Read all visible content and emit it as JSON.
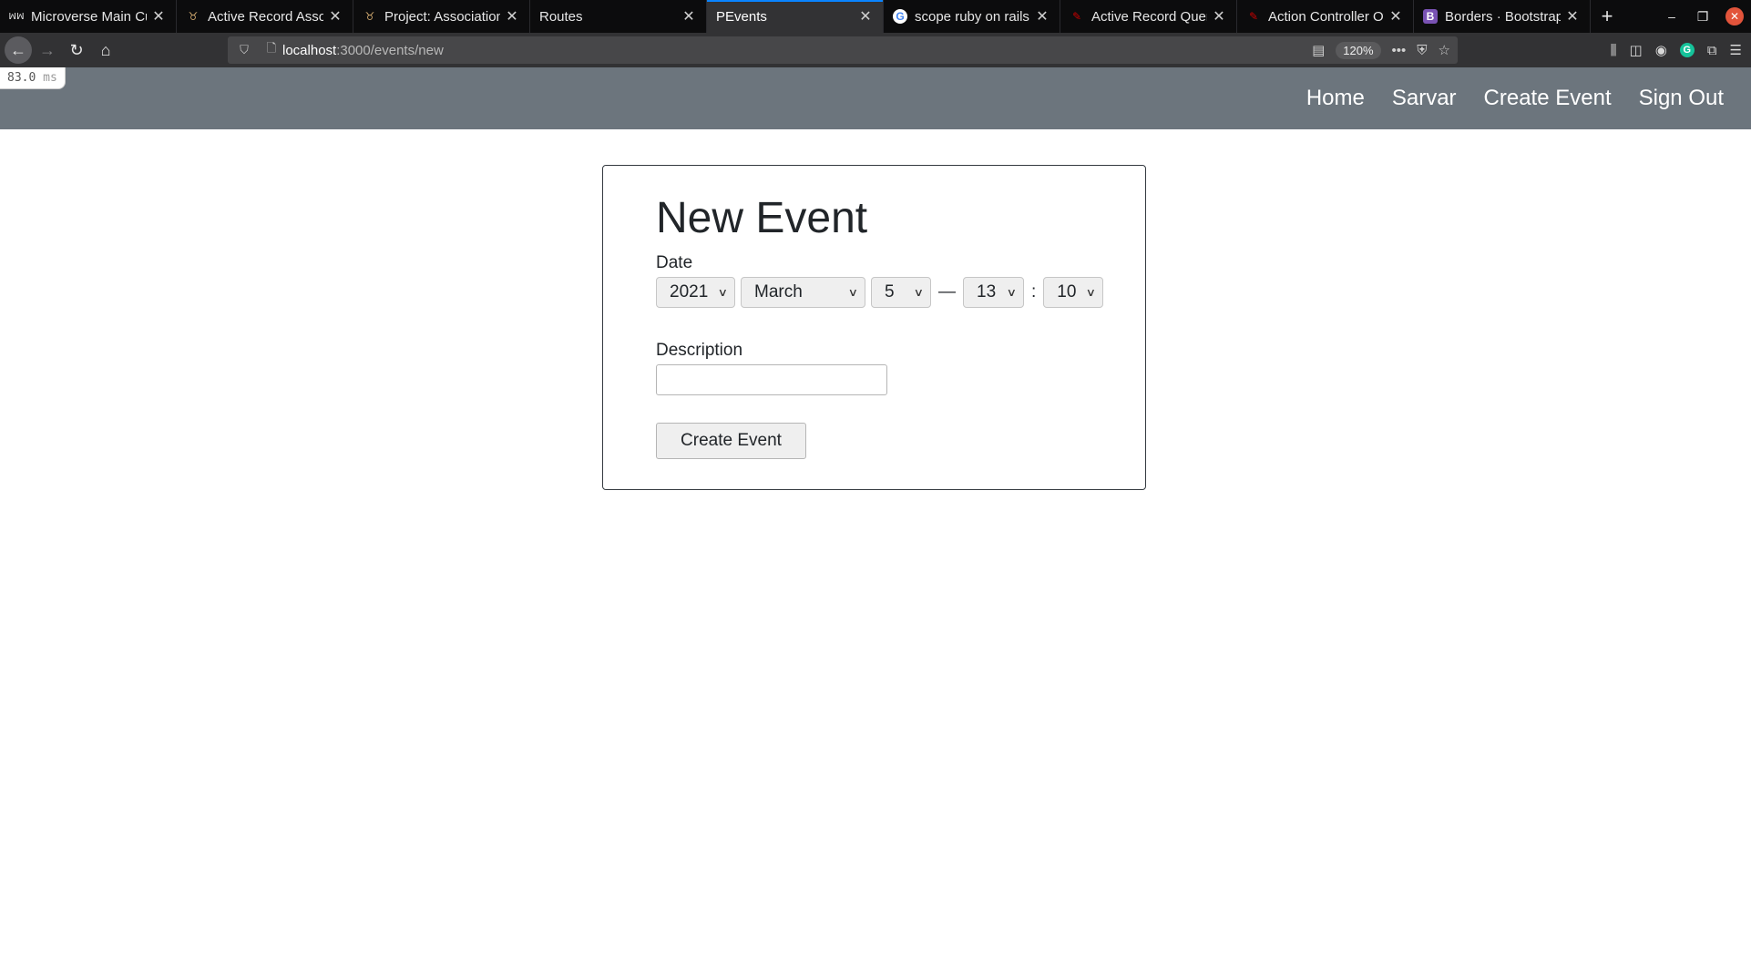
{
  "browser": {
    "tabs": [
      {
        "title": "Microverse Main Cu",
        "icon": "microverse-icon",
        "glyph": "ꟽꟽ",
        "active": false
      },
      {
        "title": "Active Record Assoc",
        "icon": "rails-icon",
        "glyph": "🐞",
        "active": false
      },
      {
        "title": "Project: Association",
        "icon": "odin-icon",
        "glyph": "🐞",
        "active": false
      },
      {
        "title": "Routes",
        "icon": "",
        "glyph": "",
        "active": false
      },
      {
        "title": "PEvents",
        "icon": "",
        "glyph": "",
        "active": true
      },
      {
        "title": "scope ruby on rails c",
        "icon": "google-icon",
        "glyph": "G",
        "active": false
      },
      {
        "title": "Active Record Query",
        "icon": "rails-icon",
        "glyph": "🐞",
        "active": false
      },
      {
        "title": "Action Controller Ov",
        "icon": "rails-icon",
        "glyph": "🐞",
        "active": false
      },
      {
        "title": "Borders · Bootstrap",
        "icon": "bootstrap-icon",
        "glyph": "B",
        "active": false
      }
    ],
    "tab_close_glyph": "✕",
    "new_tab_glyph": "+",
    "url_host": "localhost",
    "url_rest": ":3000/events/new",
    "zoom": "120%",
    "accent_color": "#0a84ff"
  },
  "profiler": {
    "value": "83.0",
    "unit": "ms"
  },
  "header": {
    "bg_color": "#6c757d",
    "links": [
      "Home",
      "Sarvar",
      "Create Event",
      "Sign Out"
    ]
  },
  "form": {
    "title": "New Event",
    "date_label": "Date",
    "year": "2021",
    "month": "March",
    "day": "5",
    "date_time_separator": "—",
    "hour": "13",
    "time_separator": ":",
    "minute": "10",
    "description_label": "Description",
    "description_value": "",
    "submit_label": "Create Event"
  }
}
